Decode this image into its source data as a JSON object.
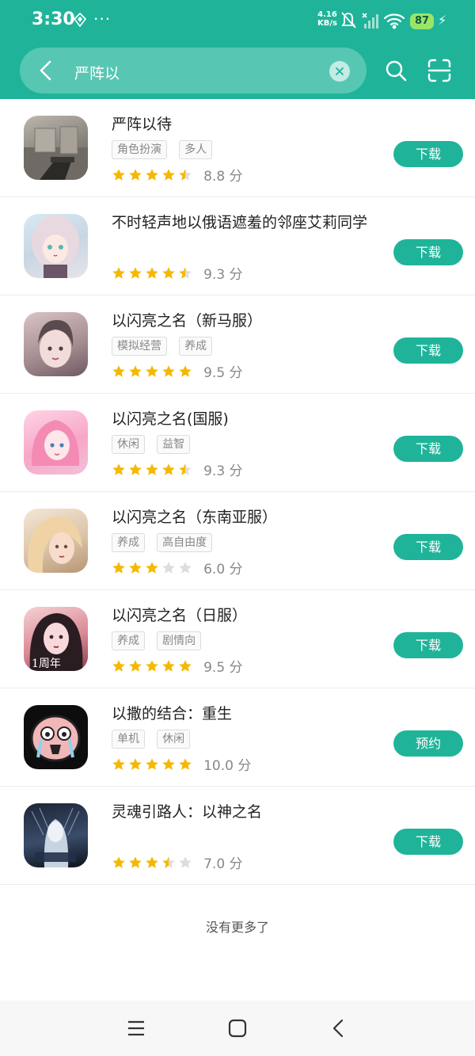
{
  "status_bar": {
    "time": "3:30",
    "dots": "···",
    "net_speed_value": "4.16",
    "net_speed_unit": "KB/s",
    "battery": "87"
  },
  "search": {
    "query": "严阵以",
    "placeholder": ""
  },
  "results": [
    {
      "title": "严阵以待",
      "tags": [
        "角色扮演",
        "多人"
      ],
      "stars": 4.5,
      "score": "8.8 分",
      "action": "下载",
      "icon": "game-icon"
    },
    {
      "title": "不时轻声地以俄语遮羞的邻座艾莉同学",
      "tags": [],
      "stars": 4.5,
      "score": "9.3 分",
      "action": "下载",
      "icon": "game-icon"
    },
    {
      "title": "以闪亮之名（新马服）",
      "tags": [
        "模拟经营",
        "养成"
      ],
      "stars": 5,
      "score": "9.5 分",
      "action": "下载",
      "icon": "game-icon"
    },
    {
      "title": "以闪亮之名(国服)",
      "tags": [
        "休闲",
        "益智"
      ],
      "stars": 4.5,
      "score": "9.3 分",
      "action": "下载",
      "icon": "game-icon"
    },
    {
      "title": "以闪亮之名（东南亚服）",
      "tags": [
        "养成",
        "高自由度"
      ],
      "stars": 3,
      "score": "6.0 分",
      "action": "下载",
      "icon": "game-icon"
    },
    {
      "title": "以闪亮之名（日服）",
      "tags": [
        "养成",
        "剧情向"
      ],
      "stars": 5,
      "score": "9.5 分",
      "action": "下载",
      "icon": "game-icon"
    },
    {
      "title": "以撒的结合：重生",
      "tags": [
        "单机",
        "休闲"
      ],
      "stars": 5,
      "score": "10.0 分",
      "action": "预约",
      "icon": "game-icon"
    },
    {
      "title": "灵魂引路人：以神之名",
      "tags": [],
      "stars": 3.5,
      "score": "7.0 分",
      "action": "下载",
      "icon": "game-icon"
    }
  ],
  "footer": {
    "no_more": "没有更多了"
  },
  "colors": {
    "accent": "#1fb49a",
    "star": "#f5b800",
    "star_empty": "#dddddd"
  },
  "icons": {
    "back": "chevron-left-icon",
    "clear": "close-icon",
    "search": "search-icon",
    "scan": "scan-icon",
    "nav_menu": "menu-icon",
    "nav_home": "home-icon",
    "nav_back": "back-icon"
  }
}
